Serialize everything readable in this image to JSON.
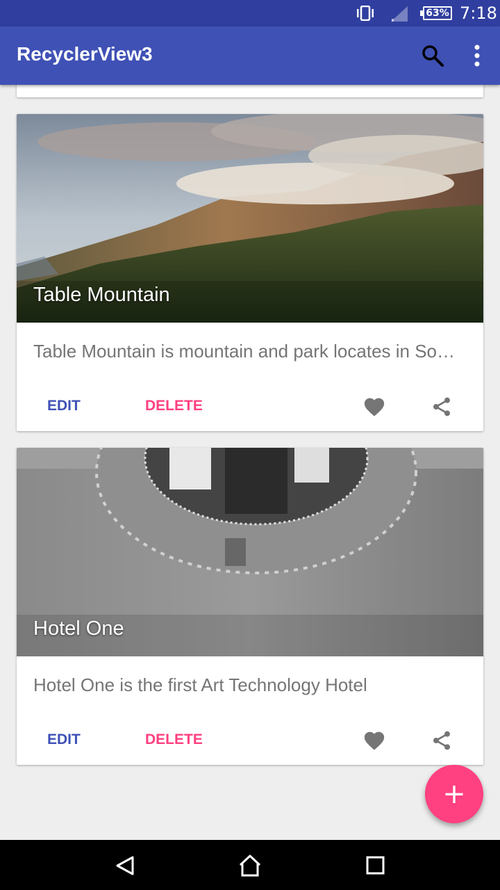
{
  "status_bar": {
    "time": "7:18",
    "battery": "63%",
    "icons": [
      "vibrate-icon",
      "signal-icon",
      "battery-icon"
    ]
  },
  "app_bar": {
    "title": "RecyclerView3",
    "actions": [
      "search-icon",
      "more-vert-icon"
    ]
  },
  "cards": [
    {
      "title": "Table Mountain",
      "description": "Table Mountain is mountain and park locates in South Africa",
      "edit_label": "EDIT",
      "delete_label": "DELETE",
      "icons": [
        "favorite-icon",
        "share-icon"
      ]
    },
    {
      "title": "Hotel One",
      "description": "Hotel One is the first Art Technology Hotel",
      "edit_label": "EDIT",
      "delete_label": "DELETE",
      "icons": [
        "favorite-icon",
        "share-icon"
      ]
    }
  ],
  "fab": {
    "label": "+"
  },
  "colors": {
    "primary": "#3f51b5",
    "primary_dark": "#303f9f",
    "accent": "#ff4081",
    "background": "#eeeeee"
  },
  "nav_bar": {
    "icons": [
      "back-icon",
      "home-icon",
      "recents-icon"
    ]
  }
}
